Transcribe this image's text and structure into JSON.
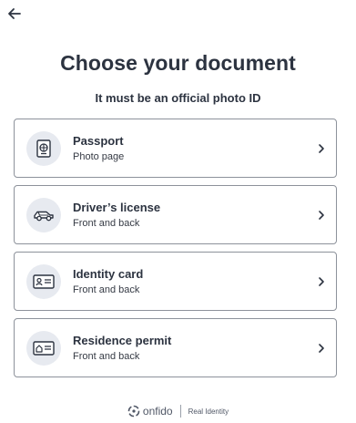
{
  "header": {
    "back_icon": "arrow-left-icon"
  },
  "title": "Choose your document",
  "subtitle": "It must be an official photo ID",
  "documents": [
    {
      "label": "Passport",
      "sub": "Photo page",
      "icon": "passport-icon"
    },
    {
      "label": "Driver’s license",
      "sub": "Front and back",
      "icon": "car-icon"
    },
    {
      "label": "Identity card",
      "sub": "Front and back",
      "icon": "id-card-icon"
    },
    {
      "label": "Residence permit",
      "sub": "Front and back",
      "icon": "home-card-icon"
    }
  ],
  "footer": {
    "brand": "onfido",
    "tagline": "Real Identity"
  },
  "colors": {
    "text": "#2c3340",
    "border": "#8d929b",
    "icon_bg": "#e7eaf0"
  }
}
